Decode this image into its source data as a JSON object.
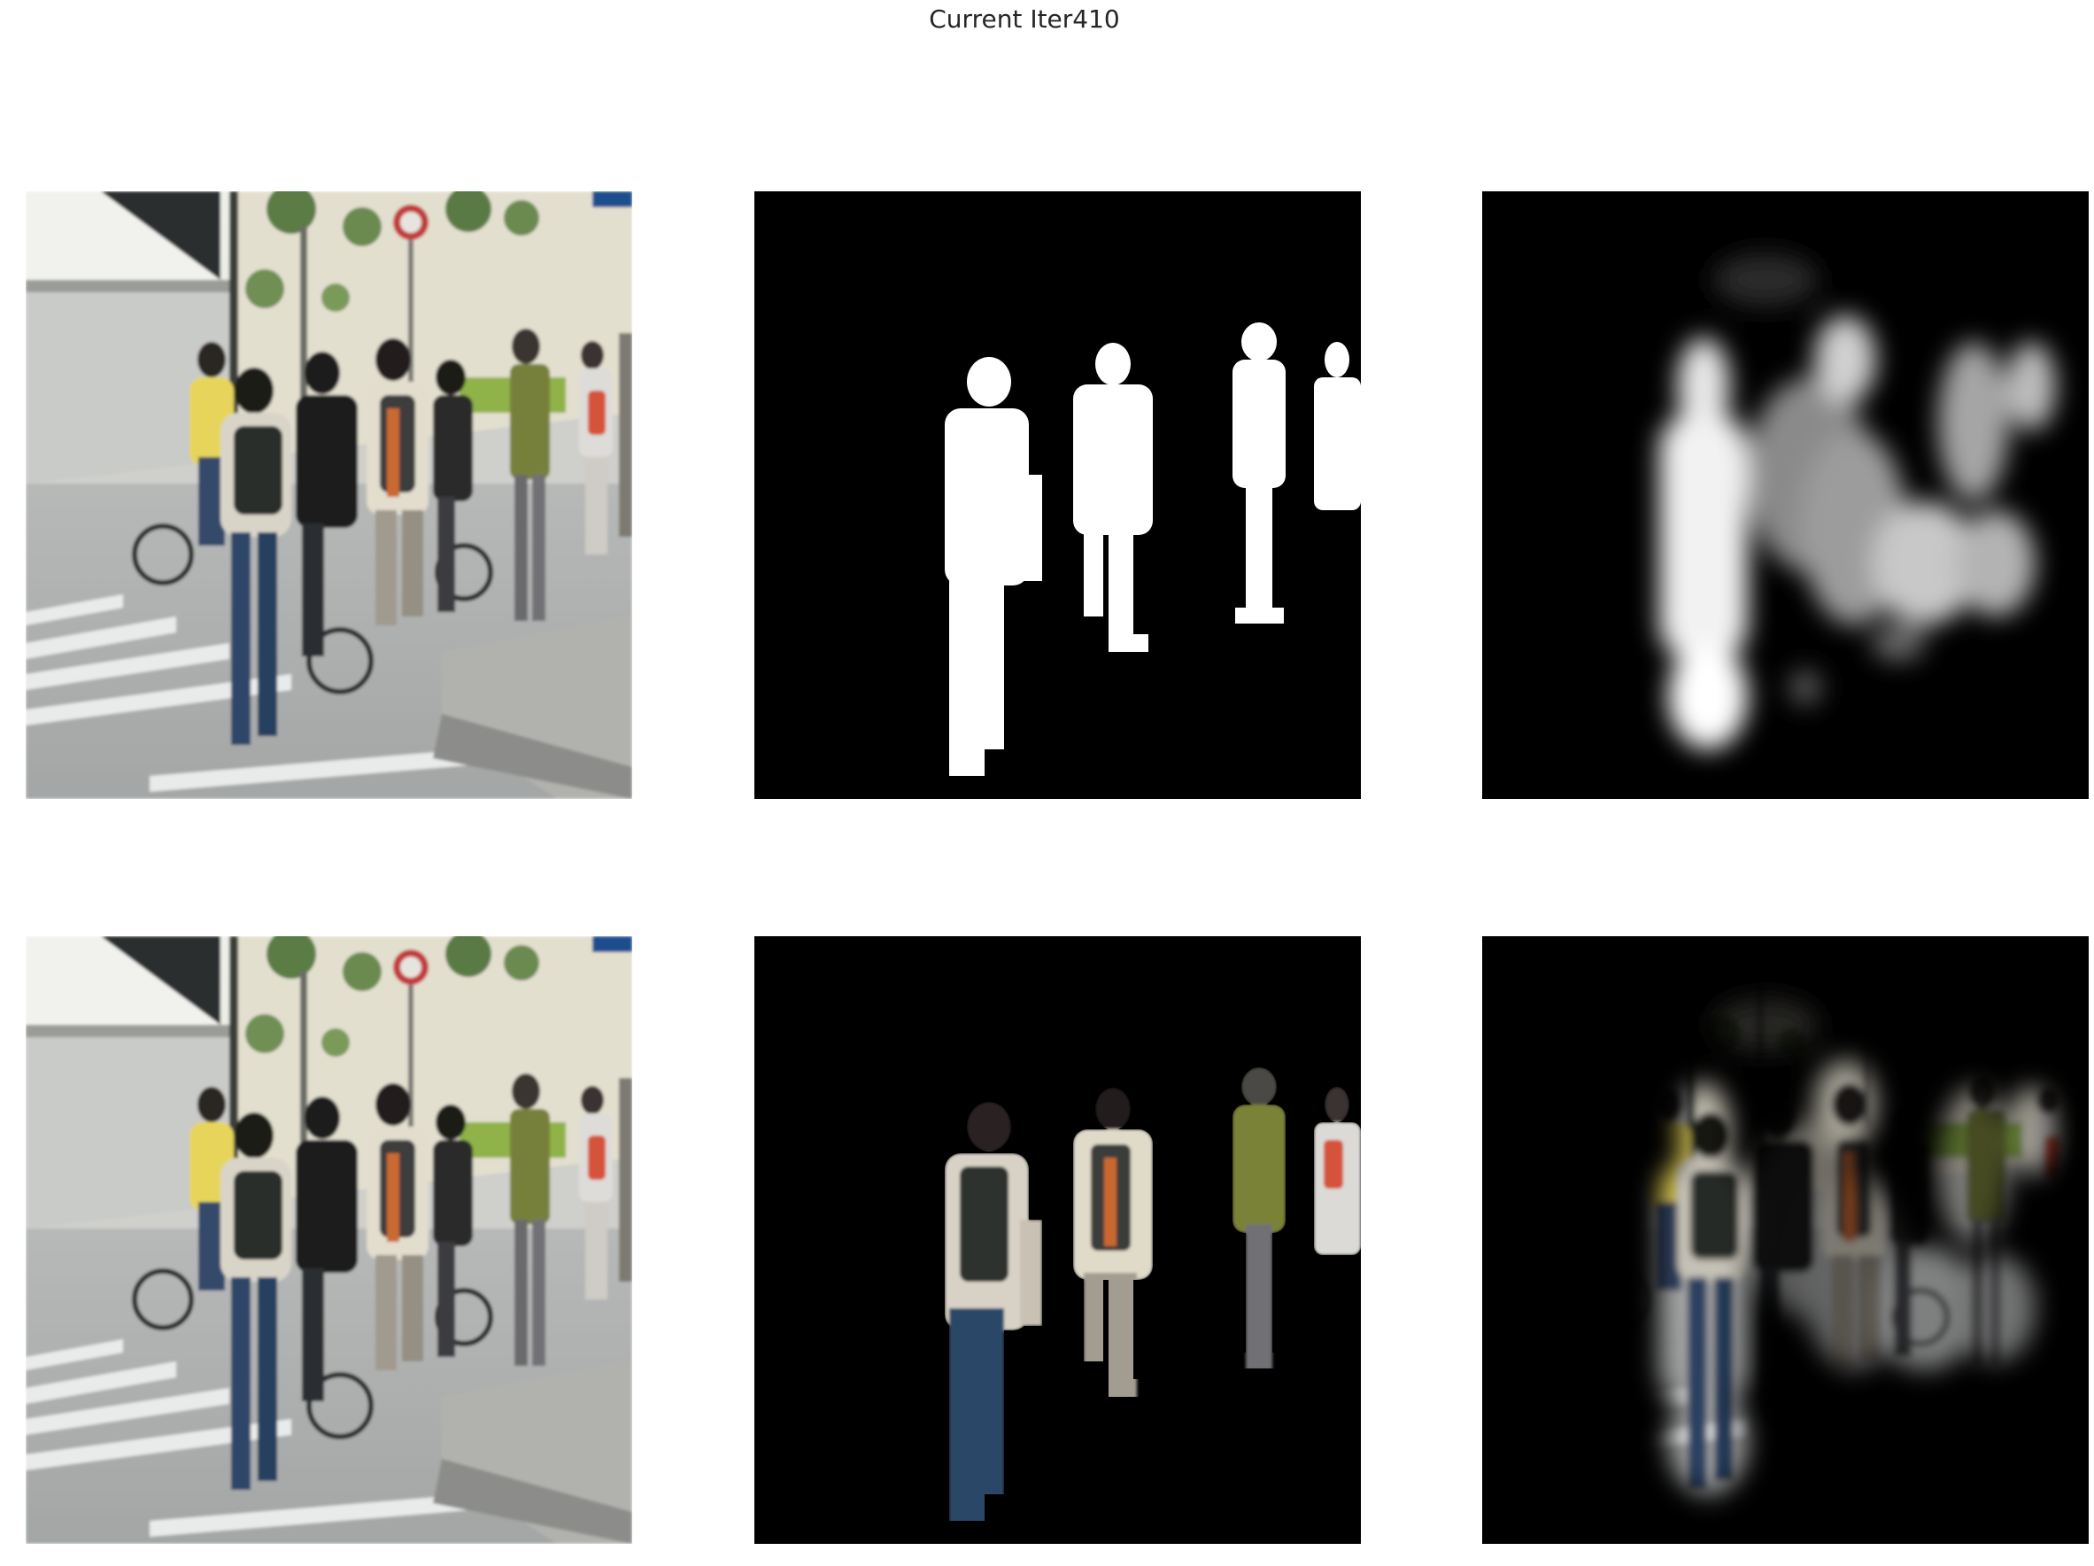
{
  "figure": {
    "title": "Current Iter410"
  },
  "panels": [
    {
      "name": "input-image",
      "kind": "photo"
    },
    {
      "name": "ground-truth-mask",
      "kind": "binary-mask"
    },
    {
      "name": "predicted-mask",
      "kind": "soft-mask"
    },
    {
      "name": "input-image-copy",
      "kind": "photo"
    },
    {
      "name": "ground-truth-masked-image",
      "kind": "masked-photo"
    },
    {
      "name": "predicted-masked-image",
      "kind": "masked-photo"
    }
  ],
  "colors": {
    "background": "#ffffff",
    "title_text": "#262626",
    "mask_black": "#000000",
    "mask_white": "#ffffff"
  }
}
